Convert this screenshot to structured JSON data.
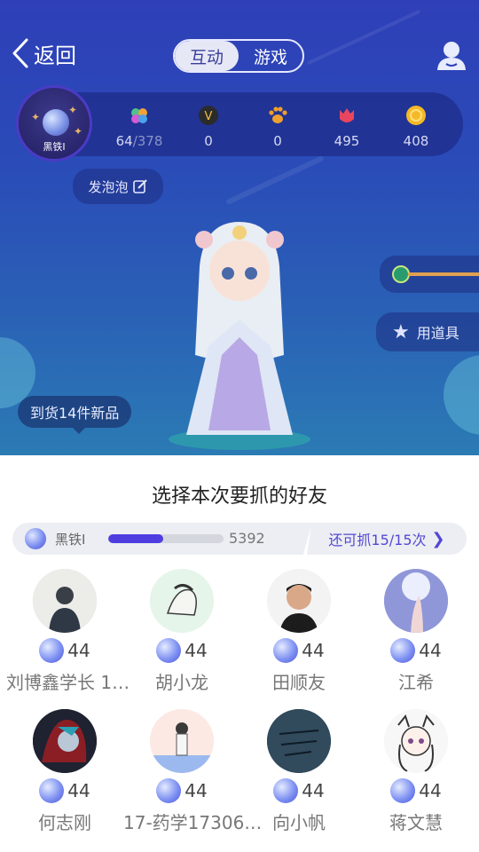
{
  "header": {
    "back_label": "返回",
    "tabs": [
      {
        "label": "互动",
        "active": true
      },
      {
        "label": "游戏",
        "active": false
      }
    ]
  },
  "rank": {
    "label": "黑铁Ⅰ"
  },
  "stats": [
    {
      "icon": "clover-icon",
      "value": "64",
      "total": "/378"
    },
    {
      "icon": "vip-badge-icon",
      "value": "0"
    },
    {
      "icon": "paw-icon",
      "value": "0"
    },
    {
      "icon": "flower-icon",
      "value": "495"
    },
    {
      "icon": "coin-icon",
      "value": "408"
    }
  ],
  "actions": {
    "bubble_label": "发泡泡",
    "prop_label": "用道具",
    "arrival_label": "到货14件新品"
  },
  "sheet": {
    "title": "选择本次要抓的好友",
    "rank_name": "黑铁Ⅰ",
    "rank_score": "5392",
    "rank_progress": 0.48,
    "remaining_label": "还可抓15/15次"
  },
  "friends": [
    {
      "name": "刘博鑫学长 1…",
      "level": "44"
    },
    {
      "name": "胡小龙",
      "level": "44"
    },
    {
      "name": "田顺友",
      "level": "44"
    },
    {
      "name": "江希",
      "level": "44"
    },
    {
      "name": "何志刚",
      "level": "44"
    },
    {
      "name": "17-药学17306…",
      "level": "44"
    },
    {
      "name": "向小帆",
      "level": "44"
    },
    {
      "name": "蒋文慧",
      "level": "44"
    }
  ],
  "colors": {
    "accent": "#4f3de0",
    "scene_top": "#2f3fb8",
    "scene_bottom": "#2b7bb4"
  }
}
